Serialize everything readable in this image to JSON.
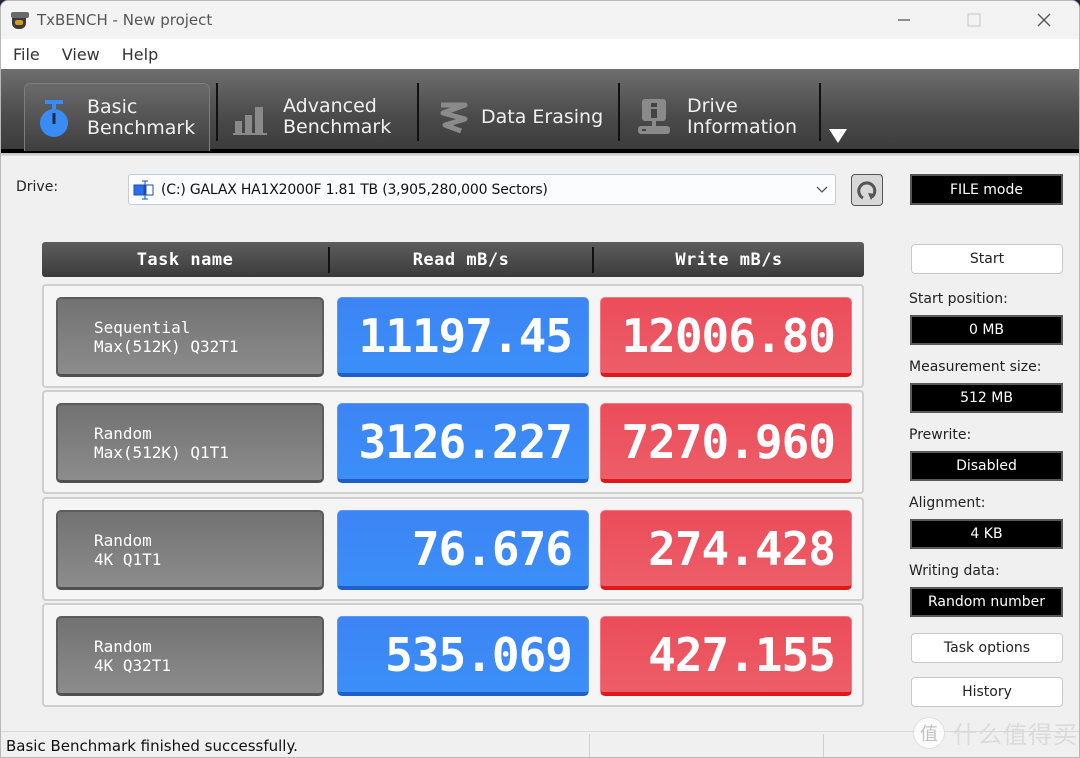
{
  "window": {
    "title": "TxBENCH - New project",
    "controls": {
      "minimize": "—",
      "maximize": "☐",
      "close": "✕"
    }
  },
  "menu": [
    "File",
    "View",
    "Help"
  ],
  "tabs": [
    {
      "line1": "Basic",
      "line2": "Benchmark",
      "icon": "stopwatch-icon",
      "active": true
    },
    {
      "line1": "Advanced",
      "line2": "Benchmark",
      "icon": "bar-chart-icon",
      "active": false
    },
    {
      "line1": "Data Erasing",
      "line2": "",
      "icon": "spring-icon",
      "active": false
    },
    {
      "line1": "Drive",
      "line2": "Information",
      "icon": "drive-info-icon",
      "active": false
    }
  ],
  "drive": {
    "label": "Drive:",
    "selected": "(C:) GALAX HA1X2000F  1.81 TB (3,905,280,000 Sectors)",
    "mode": "FILE mode"
  },
  "table": {
    "headers": [
      "Task name",
      "Read mB/s",
      "Write mB/s"
    ],
    "rows": [
      {
        "task_line1": "Sequential",
        "task_line2": "Max(512K) Q32T1",
        "read": "11197.45",
        "write": "12006.80"
      },
      {
        "task_line1": "Random",
        "task_line2": "Max(512K) Q1T1",
        "read": "3126.227",
        "write": "7270.960"
      },
      {
        "task_line1": "Random",
        "task_line2": "4K Q1T1",
        "read": "76.676",
        "write": "274.428"
      },
      {
        "task_line1": "Random",
        "task_line2": "4K Q32T1",
        "read": "535.069",
        "write": "427.155"
      }
    ]
  },
  "side": {
    "start_button": "Start",
    "start_position_label": "Start position:",
    "start_position_value": "0 MB",
    "measurement_size_label": "Measurement size:",
    "measurement_size_value": "512 MB",
    "prewrite_label": "Prewrite:",
    "prewrite_value": "Disabled",
    "alignment_label": "Alignment:",
    "alignment_value": "4 KB",
    "writing_data_label": "Writing data:",
    "writing_data_value": "Random number",
    "task_options_button": "Task options",
    "history_button": "History"
  },
  "status": {
    "message": "Basic Benchmark finished successfully."
  },
  "watermark": {
    "glyph": "值",
    "text": "什么值得买"
  },
  "colors": {
    "read": "#3d8af7",
    "write": "#ec5560",
    "toolbar": "#4a4a4a",
    "accent_icon": "#3a8cf5"
  }
}
